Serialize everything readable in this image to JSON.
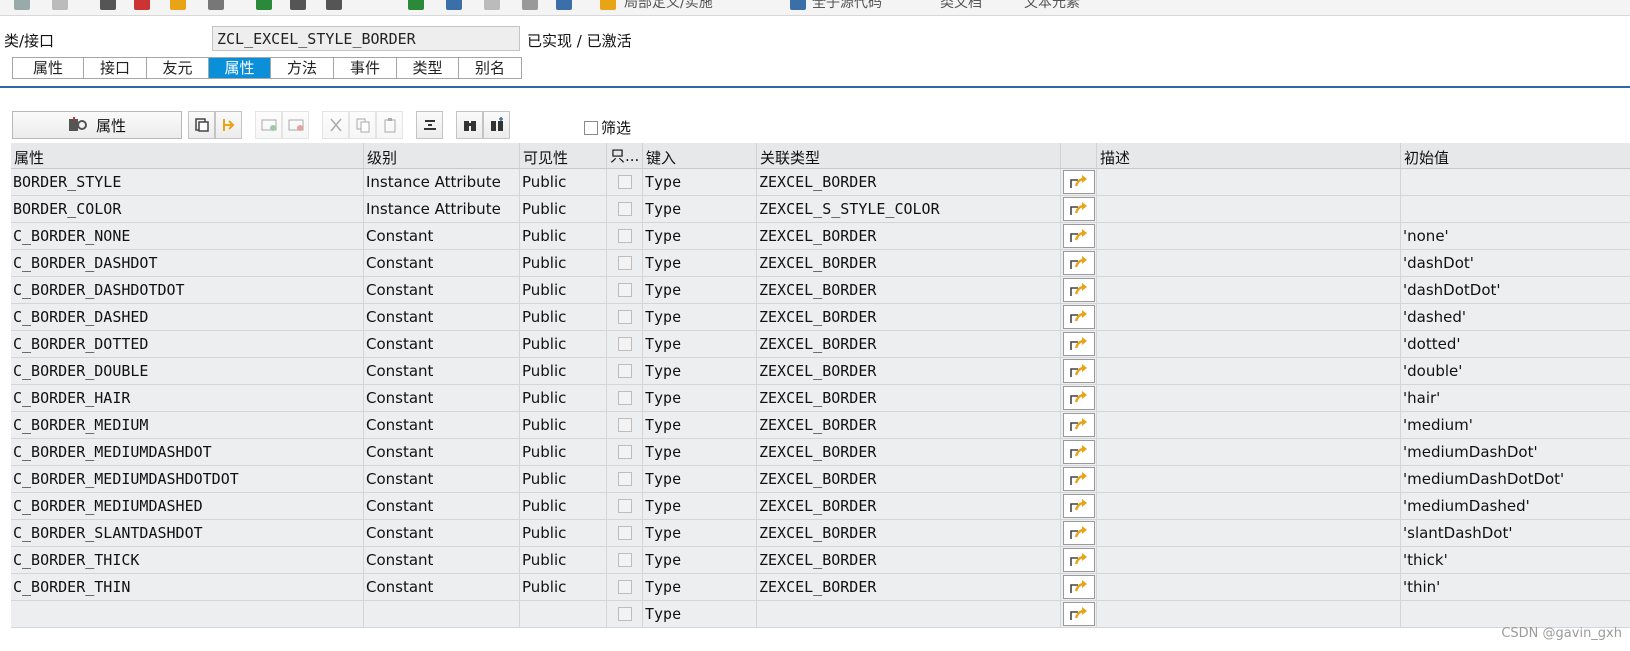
{
  "topbar": {
    "items": [
      "局部定义/实施",
      "全子源代码",
      "类文档",
      "文本元素"
    ]
  },
  "header": {
    "label": "类/接口",
    "class_name": "ZCL_EXCEL_STYLE_BORDER",
    "status": "已实现 / 已激活"
  },
  "tabs": [
    {
      "label": "属性",
      "active": false
    },
    {
      "label": "接口",
      "active": false
    },
    {
      "label": "友元",
      "active": false
    },
    {
      "label": "属性",
      "active": true
    },
    {
      "label": "方法",
      "active": false
    },
    {
      "label": "事件",
      "active": false
    },
    {
      "label": "类型",
      "active": false
    },
    {
      "label": "别名",
      "active": false
    }
  ],
  "toolbar": {
    "main_label": "属性",
    "filter_label": "筛选"
  },
  "grid": {
    "columns": [
      "属性",
      "级别",
      "可见性",
      "只...",
      "键入",
      "关联类型",
      "",
      "描述",
      "初始值"
    ],
    "rows": [
      {
        "attr": "BORDER_STYLE",
        "level": "Instance Attribute",
        "visibility": "Public",
        "typing": "Type",
        "assoc": "ZEXCEL_BORDER",
        "desc": "",
        "init": ""
      },
      {
        "attr": "BORDER_COLOR",
        "level": "Instance Attribute",
        "visibility": "Public",
        "typing": "Type",
        "assoc": "ZEXCEL_S_STYLE_COLOR",
        "desc": "",
        "init": ""
      },
      {
        "attr": "C_BORDER_NONE",
        "level": "Constant",
        "visibility": "Public",
        "typing": "Type",
        "assoc": "ZEXCEL_BORDER",
        "desc": "",
        "init": "'none'"
      },
      {
        "attr": "C_BORDER_DASHDOT",
        "level": "Constant",
        "visibility": "Public",
        "typing": "Type",
        "assoc": "ZEXCEL_BORDER",
        "desc": "",
        "init": "'dashDot'"
      },
      {
        "attr": "C_BORDER_DASHDOTDOT",
        "level": "Constant",
        "visibility": "Public",
        "typing": "Type",
        "assoc": "ZEXCEL_BORDER",
        "desc": "",
        "init": "'dashDotDot'"
      },
      {
        "attr": "C_BORDER_DASHED",
        "level": "Constant",
        "visibility": "Public",
        "typing": "Type",
        "assoc": "ZEXCEL_BORDER",
        "desc": "",
        "init": "'dashed'"
      },
      {
        "attr": "C_BORDER_DOTTED",
        "level": "Constant",
        "visibility": "Public",
        "typing": "Type",
        "assoc": "ZEXCEL_BORDER",
        "desc": "",
        "init": "'dotted'"
      },
      {
        "attr": "C_BORDER_DOUBLE",
        "level": "Constant",
        "visibility": "Public",
        "typing": "Type",
        "assoc": "ZEXCEL_BORDER",
        "desc": "",
        "init": "'double'"
      },
      {
        "attr": "C_BORDER_HAIR",
        "level": "Constant",
        "visibility": "Public",
        "typing": "Type",
        "assoc": "ZEXCEL_BORDER",
        "desc": "",
        "init": "'hair'"
      },
      {
        "attr": "C_BORDER_MEDIUM",
        "level": "Constant",
        "visibility": "Public",
        "typing": "Type",
        "assoc": "ZEXCEL_BORDER",
        "desc": "",
        "init": "'medium'"
      },
      {
        "attr": "C_BORDER_MEDIUMDASHDOT",
        "level": "Constant",
        "visibility": "Public",
        "typing": "Type",
        "assoc": "ZEXCEL_BORDER",
        "desc": "",
        "init": "'mediumDashDot'"
      },
      {
        "attr": "C_BORDER_MEDIUMDASHDOTDOT",
        "level": "Constant",
        "visibility": "Public",
        "typing": "Type",
        "assoc": "ZEXCEL_BORDER",
        "desc": "",
        "init": "'mediumDashDotDot'"
      },
      {
        "attr": "C_BORDER_MEDIUMDASHED",
        "level": "Constant",
        "visibility": "Public",
        "typing": "Type",
        "assoc": "ZEXCEL_BORDER",
        "desc": "",
        "init": "'mediumDashed'"
      },
      {
        "attr": "C_BORDER_SLANTDASHDOT",
        "level": "Constant",
        "visibility": "Public",
        "typing": "Type",
        "assoc": "ZEXCEL_BORDER",
        "desc": "",
        "init": "'slantDashDot'"
      },
      {
        "attr": "C_BORDER_THICK",
        "level": "Constant",
        "visibility": "Public",
        "typing": "Type",
        "assoc": "ZEXCEL_BORDER",
        "desc": "",
        "init": "'thick'"
      },
      {
        "attr": "C_BORDER_THIN",
        "level": "Constant",
        "visibility": "Public",
        "typing": "Type",
        "assoc": "ZEXCEL_BORDER",
        "desc": "",
        "init": "'thin'"
      },
      {
        "attr": "",
        "level": "",
        "visibility": "",
        "typing": "Type",
        "assoc": "",
        "desc": "",
        "init": ""
      }
    ]
  },
  "watermark": "CSDN @gavin_gxh",
  "colors": {
    "active_tab": "#0a8fd8",
    "tab_underline": "#2d6aa8",
    "row_bg": "#eceef0",
    "header_bg": "#e6e8ea",
    "nav_icon": "#e8a317"
  }
}
